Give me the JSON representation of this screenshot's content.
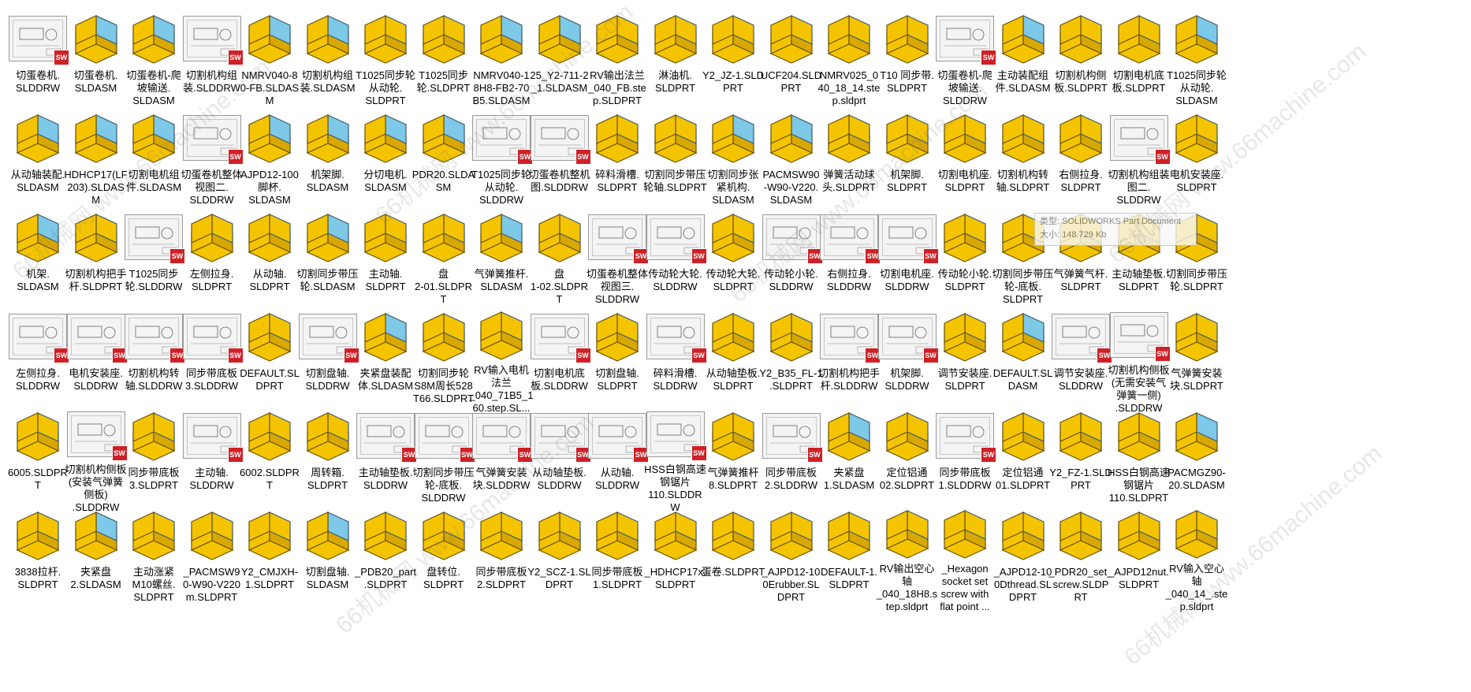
{
  "files": [
    {
      "name": "切蛋卷机.\nSLDDRW",
      "icon": "drawing-icon"
    },
    {
      "name": "切蛋卷机.\nSLDASM",
      "icon": "assembly-icon"
    },
    {
      "name": "切蛋卷机-爬\n坡输送.\nSLDASM",
      "icon": "assembly-icon"
    },
    {
      "name": "切割机构组\n装.SLDDRW",
      "icon": "drawing-icon"
    },
    {
      "name": "NMRV040-8\n0-FB.SLDAS\nM",
      "icon": "assembly-icon"
    },
    {
      "name": "切割机构组\n装.SLDASM",
      "icon": "assembly-icon"
    },
    {
      "name": "T1025同步轮\n从动轮.\nSLDPRT",
      "icon": "part-icon"
    },
    {
      "name": "T1025同步\n轮.SLDPRT",
      "icon": "part-icon"
    },
    {
      "name": "NMRV040-1\n8H8-FB2-70\nB5.SLDASM",
      "icon": "assembly-icon"
    },
    {
      "name": "25_Y2-711-2\n_1.SLDASM",
      "icon": "assembly-icon"
    },
    {
      "name": "RV输出法兰\n_040_FB.ste\np.SLDPRT",
      "icon": "part-icon"
    },
    {
      "name": "淋油机.\nSLDPRT",
      "icon": "part-icon"
    },
    {
      "name": "Y2_JZ-1.SLD\nPRT",
      "icon": "part-icon"
    },
    {
      "name": "UCF204.SLD\nPRT",
      "icon": "part-icon"
    },
    {
      "name": "NMRV025_0\n40_18_14.ste\np.sldprt",
      "icon": "part-icon"
    },
    {
      "name": "T10 同步带.\nSLDPRT",
      "icon": "part-icon"
    },
    {
      "name": "切蛋卷机-爬\n坡输送.\nSLDDRW",
      "icon": "drawing-icon"
    },
    {
      "name": "主动装配组\n件.SLDASM",
      "icon": "assembly-icon"
    },
    {
      "name": "切割机构侧\n板.SLDPRT",
      "icon": "part-icon"
    },
    {
      "name": "切割电机底\n板.SLDPRT",
      "icon": "part-icon"
    },
    {
      "name": "T1025同步轮\n从动轮.\nSLDASM",
      "icon": "assembly-icon"
    },
    {
      "name": "从动轴装配.\nSLDASM",
      "icon": "assembly-icon"
    },
    {
      "name": "HDHCP17(LF\n203).SLDAS\nM",
      "icon": "assembly-icon"
    },
    {
      "name": "切割电机组\n件.SLDASM",
      "icon": "assembly-icon"
    },
    {
      "name": "切蛋卷机整体\n视图二.\nSLDDRW",
      "icon": "drawing-icon"
    },
    {
      "name": "AJPD12-100\n脚杯.\nSLDASM",
      "icon": "assembly-icon"
    },
    {
      "name": "机架脚.\nSLDASM",
      "icon": "assembly-icon"
    },
    {
      "name": "分切电机.\nSLDASM",
      "icon": "assembly-icon"
    },
    {
      "name": "PDR20.SLDA\nSM",
      "icon": "assembly-icon"
    },
    {
      "name": "T1025同步轮\n从动轮.\nSLDDRW",
      "icon": "drawing-icon"
    },
    {
      "name": "切蛋卷机整机\n图.SLDDRW",
      "icon": "drawing-icon"
    },
    {
      "name": "碎料滑槽.\nSLDPRT",
      "icon": "part-icon"
    },
    {
      "name": "切割同步带压\n轮轴.SLDPRT",
      "icon": "part-icon"
    },
    {
      "name": "切割同步张\n紧机构.\nSLDASM",
      "icon": "assembly-icon"
    },
    {
      "name": "PACMSW90\n-W90-V220.\nSLDASM",
      "icon": "assembly-icon"
    },
    {
      "name": "弹簧活动球\n头.SLDPRT",
      "icon": "part-icon"
    },
    {
      "name": "机架脚.\nSLDPRT",
      "icon": "part-icon"
    },
    {
      "name": "切割电机座.\nSLDPRT",
      "icon": "part-icon"
    },
    {
      "name": "切割机构转\n轴.SLDPRT",
      "icon": "part-icon"
    },
    {
      "name": "右侧拉身.\nSLDPRT",
      "icon": "part-icon"
    },
    {
      "name": "切割机构组装\n图二.\nSLDDRW",
      "icon": "drawing-icon"
    },
    {
      "name": "电机安装座.\nSLDPRT",
      "icon": "part-icon"
    },
    {
      "name": "机架.\nSLDASM",
      "icon": "assembly-icon"
    },
    {
      "name": "切割机构把手\n杆.SLDPRT",
      "icon": "part-icon"
    },
    {
      "name": "T1025同步\n轮.SLDDRW",
      "icon": "drawing-icon"
    },
    {
      "name": "左侧拉身.\nSLDPRT",
      "icon": "part-icon"
    },
    {
      "name": "从动轴.\nSLDPRT",
      "icon": "part-icon"
    },
    {
      "name": "切割同步带压\n轮.SLDASM",
      "icon": "assembly-icon"
    },
    {
      "name": "主动轴.\nSLDPRT",
      "icon": "part-icon"
    },
    {
      "name": "盘\n2-01.SLDPR\nT",
      "icon": "part-icon"
    },
    {
      "name": "气弹簧推杆.\nSLDASM",
      "icon": "assembly-icon"
    },
    {
      "name": "盘\n1-02.SLDPR\nT",
      "icon": "part-icon"
    },
    {
      "name": "切蛋卷机整体\n视图三.\nSLDDRW",
      "icon": "drawing-icon"
    },
    {
      "name": "传动轮大轮.\nSLDDRW",
      "icon": "drawing-icon"
    },
    {
      "name": "传动轮大轮.\nSLDPRT",
      "icon": "part-icon"
    },
    {
      "name": "传动轮小轮.\nSLDDRW",
      "icon": "drawing-icon"
    },
    {
      "name": "右侧拉身.\nSLDDRW",
      "icon": "drawing-icon"
    },
    {
      "name": "切割电机座.\nSLDDRW",
      "icon": "drawing-icon"
    },
    {
      "name": "传动轮小轮.\nSLDPRT",
      "icon": "part-icon"
    },
    {
      "name": "切割同步带压\n轮-底板.\nSLDPRT",
      "icon": "part-icon"
    },
    {
      "name": "气弹簧气杆.\nSLDPRT",
      "icon": "part-icon"
    },
    {
      "name": "主动轴垫板.\nSLDPRT",
      "icon": "part-icon"
    },
    {
      "name": "切割同步带压\n轮.SLDPRT",
      "icon": "part-icon"
    },
    {
      "name": "左侧拉身.\nSLDDRW",
      "icon": "drawing-icon"
    },
    {
      "name": "电机安装座.\nSLDDRW",
      "icon": "drawing-icon"
    },
    {
      "name": "切割机构转\n轴.SLDDRW",
      "icon": "drawing-icon"
    },
    {
      "name": "同步带底板\n3.SLDDRW",
      "icon": "drawing-icon"
    },
    {
      "name": "DEFAULT.SL\nDPRT",
      "icon": "part-icon"
    },
    {
      "name": "切割盘轴.\nSLDDRW",
      "icon": "drawing-icon"
    },
    {
      "name": "夹紧盘装配\n体.SLDASM",
      "icon": "assembly-icon"
    },
    {
      "name": "切割同步轮\nS8M周长528\nT66.SLDPRT",
      "icon": "part-icon"
    },
    {
      "name": "RV输入电机\n法兰\n_040_71B5_1\n60.step.SL...",
      "icon": "part-icon"
    },
    {
      "name": "切割电机底\n板.SLDDRW",
      "icon": "drawing-icon"
    },
    {
      "name": "切割盘轴.\nSLDPRT",
      "icon": "part-icon"
    },
    {
      "name": "碎料滑槽.\nSLDDRW",
      "icon": "drawing-icon"
    },
    {
      "name": "从动轴垫板.\nSLDPRT",
      "icon": "part-icon"
    },
    {
      "name": "Y2_B35_FL-1\n.SLDPRT",
      "icon": "part-icon"
    },
    {
      "name": "切割机构把手\n杆.SLDDRW",
      "icon": "drawing-icon"
    },
    {
      "name": "机架脚.\nSLDDRW",
      "icon": "drawing-icon"
    },
    {
      "name": "调节安装座.\nSLDPRT",
      "icon": "part-icon"
    },
    {
      "name": "DEFAULT.SL\nDASM",
      "icon": "assembly-icon"
    },
    {
      "name": "调节安装座.\nSLDDRW",
      "icon": "drawing-icon"
    },
    {
      "name": "切割机构侧板\n(无需安装气\n弹簧一侧)\n.SLDDRW",
      "icon": "drawing-icon"
    },
    {
      "name": "气弹簧安装\n块.SLDPRT",
      "icon": "part-icon"
    },
    {
      "name": "6005.SLDPR\nT",
      "icon": "part-icon"
    },
    {
      "name": "切割机构侧板\n(安装气弹簧\n侧板)\n.SLDDRW",
      "icon": "drawing-icon"
    },
    {
      "name": "同步带底板\n3.SLDPRT",
      "icon": "part-icon"
    },
    {
      "name": "主动轴.\nSLDDRW",
      "icon": "drawing-icon"
    },
    {
      "name": "6002.SLDPR\nT",
      "icon": "part-icon"
    },
    {
      "name": "周转箱.\nSLDPRT",
      "icon": "part-icon"
    },
    {
      "name": "主动轴垫板.\nSLDDRW",
      "icon": "drawing-icon"
    },
    {
      "name": "切割同步带压\n轮-底板.\nSLDDRW",
      "icon": "drawing-icon"
    },
    {
      "name": "气弹簧安装\n块.SLDDRW",
      "icon": "drawing-icon"
    },
    {
      "name": "从动轴垫板.\nSLDDRW",
      "icon": "drawing-icon"
    },
    {
      "name": "从动轴.\nSLDDRW",
      "icon": "drawing-icon"
    },
    {
      "name": "HSS白钢高速\n钢锯片\n110.SLDDR\nW",
      "icon": "drawing-icon"
    },
    {
      "name": "气弹簧推杆\n8.SLDPRT",
      "icon": "part-icon"
    },
    {
      "name": "同步带底板\n2.SLDDRW",
      "icon": "drawing-icon"
    },
    {
      "name": "夹紧盘\n1.SLDASM",
      "icon": "assembly-icon"
    },
    {
      "name": "定位铝通\n02.SLDPRT",
      "icon": "part-icon"
    },
    {
      "name": "同步带底板\n1.SLDDRW",
      "icon": "drawing-icon"
    },
    {
      "name": "定位铝通\n01.SLDPRT",
      "icon": "part-icon"
    },
    {
      "name": "Y2_FZ-1.SLD\nPRT",
      "icon": "part-icon"
    },
    {
      "name": "HSS白钢高速\n钢锯片\n110.SLDPRT",
      "icon": "part-icon"
    },
    {
      "name": "PACMGZ90-\n20.SLDASM",
      "icon": "assembly-icon"
    },
    {
      "name": "3838拉杆.\nSLDPRT",
      "icon": "part-icon"
    },
    {
      "name": "夹紧盘\n2.SLDASM",
      "icon": "assembly-icon"
    },
    {
      "name": "主动涨紧\nM10螺丝.\nSLDPRT",
      "icon": "part-icon"
    },
    {
      "name": "_PACMSW9\n0-W90-V220\nm.SLDPRT",
      "icon": "part-icon"
    },
    {
      "name": "Y2_CMJXH-\n1.SLDPRT",
      "icon": "part-icon"
    },
    {
      "name": "切割盘轴.\nSLDASM",
      "icon": "assembly-icon"
    },
    {
      "name": "_PDB20_part\n.SLDPRT",
      "icon": "part-icon"
    },
    {
      "name": "盘转位.\nSLDPRT",
      "icon": "part-icon"
    },
    {
      "name": "同步带底板\n2.SLDPRT",
      "icon": "part-icon"
    },
    {
      "name": "Y2_SCZ-1.SL\nDPRT",
      "icon": "part-icon"
    },
    {
      "name": "同步带底板\n1.SLDPRT",
      "icon": "part-icon"
    },
    {
      "name": "_HDHCP17x.\nSLDPRT",
      "icon": "part-icon"
    },
    {
      "name": "蛋卷.SLDPRT",
      "icon": "part-icon"
    },
    {
      "name": "_AJPD12-10\n0Erubber.SL\nDPRT",
      "icon": "part-icon"
    },
    {
      "name": "DEFAULT-1.\nSLDPRT",
      "icon": "part-icon"
    },
    {
      "name": "RV输出空心\n轴\n_040_18H8.s\ntep.sldprt",
      "icon": "part-icon"
    },
    {
      "name": "_Hexagon\nsocket set\nscrew with\nflat point ...",
      "icon": "part-icon"
    },
    {
      "name": "_AJPD12-10\n0Dthread.SL\nDPRT",
      "icon": "part-icon"
    },
    {
      "name": "_PDR20_set_\nscrew.SLDP\nRT",
      "icon": "part-icon"
    },
    {
      "name": "_AJPD12nut.\nSLDPRT",
      "icon": "part-icon"
    },
    {
      "name": "RV输入空心\n轴\n_040_14_.ste\np.sldprt",
      "icon": "part-icon"
    }
  ],
  "tooltip": {
    "type_line": "类型: SOLIDWORKS Part Document",
    "size_line": "大小: 148.729 Kb"
  },
  "colors": {
    "part_yellow": "#f5c400",
    "part_yellow_dark": "#d9a800",
    "assembly_blue": "#7ec8e8",
    "drawing_badge": "#d02026"
  },
  "watermark_text": "66机械网 www.66machine.com"
}
